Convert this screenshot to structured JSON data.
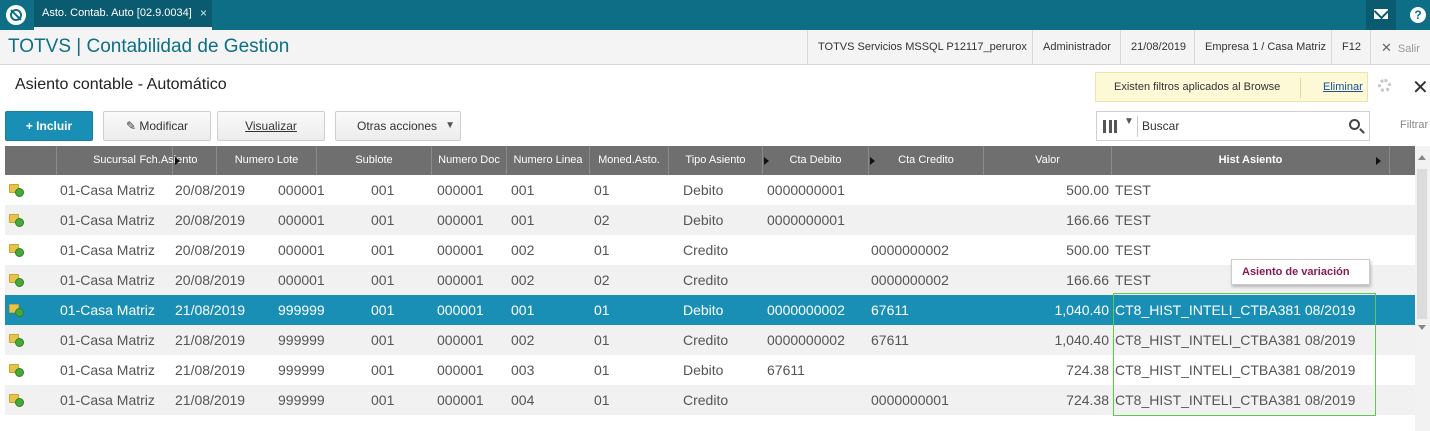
{
  "topbar": {
    "tab_label": "Asto. Contab. Auto [02.9.0034]",
    "tab_close": "×"
  },
  "header": {
    "title": "TOTVS | Contabilidad de Gestion",
    "server": "TOTVS Servicios MSSQL P12117_perurox",
    "user": "Administrador",
    "date": "21/08/2019",
    "company": "Empresa 1 / Casa Matriz",
    "shortcut": "F12",
    "exit_label": "Salir"
  },
  "page": {
    "title": "Asiento contable - Automático",
    "filter_notice": "Existen filtros aplicados al Browse",
    "filter_remove": "Eliminar"
  },
  "toolbar": {
    "include": "Incluir",
    "modify": "Modificar",
    "view": "Visualizar",
    "other": "Otras acciones"
  },
  "search": {
    "placeholder": "Buscar",
    "filter_label": "Filtrar"
  },
  "grid": {
    "columns": [
      "Sucursal",
      "Fch.Asiento",
      "Numero Lote",
      "Sublote",
      "Numero Doc",
      "Numero Linea",
      "Moned.Asto.",
      "Tipo Asiento",
      "Cta Debito",
      "Cta Credito",
      "Valor",
      "Hist Asiento"
    ],
    "rows": [
      [
        "01-Casa Matriz",
        "20/08/2019",
        "000001",
        "001",
        "000001",
        "001",
        "01",
        "Debito",
        "0000000001",
        "",
        "500.00",
        "TEST"
      ],
      [
        "01-Casa Matriz",
        "20/08/2019",
        "000001",
        "001",
        "000001",
        "001",
        "02",
        "Debito",
        "0000000001",
        "",
        "166.66",
        "TEST"
      ],
      [
        "01-Casa Matriz",
        "20/08/2019",
        "000001",
        "001",
        "000001",
        "002",
        "01",
        "Credito",
        "",
        "0000000002",
        "500.00",
        "TEST"
      ],
      [
        "01-Casa Matriz",
        "20/08/2019",
        "000001",
        "001",
        "000001",
        "002",
        "02",
        "Credito",
        "",
        "0000000002",
        "166.66",
        "TEST"
      ],
      [
        "01-Casa Matriz",
        "21/08/2019",
        "999999",
        "001",
        "000001",
        "001",
        "01",
        "Debito",
        "0000000002",
        "67611",
        "1,040.40",
        "CT8_HIST_INTELI_CTBA381 08/2019"
      ],
      [
        "01-Casa Matriz",
        "21/08/2019",
        "999999",
        "001",
        "000001",
        "002",
        "01",
        "Credito",
        "0000000002",
        "67611",
        "1,040.40",
        "CT8_HIST_INTELI_CTBA381 08/2019"
      ],
      [
        "01-Casa Matriz",
        "21/08/2019",
        "999999",
        "001",
        "000001",
        "003",
        "01",
        "Debito",
        "67611",
        "",
        "724.38",
        "CT8_HIST_INTELI_CTBA381 08/2019"
      ],
      [
        "01-Casa Matriz",
        "21/08/2019",
        "999999",
        "001",
        "000001",
        "004",
        "01",
        "Credito",
        "",
        "0000000001",
        "724.38",
        "CT8_HIST_INTELI_CTBA381 08/2019"
      ]
    ],
    "selected_row": 4
  },
  "tooltip": {
    "text": "Asiento de variación"
  },
  "colors": {
    "topbar": "#0e6e86",
    "accent": "#1a8fb5",
    "grid_header": "#6f6f6f",
    "tooltip_text": "#8a1a52",
    "highlight_border": "#5fc84e"
  },
  "icons": [
    "totvs-logo-icon",
    "mail-icon",
    "help-icon",
    "close-icon",
    "gear-icon",
    "plus-icon",
    "pencil-icon",
    "columns-icon",
    "search-icon",
    "folder-status-icon"
  ]
}
